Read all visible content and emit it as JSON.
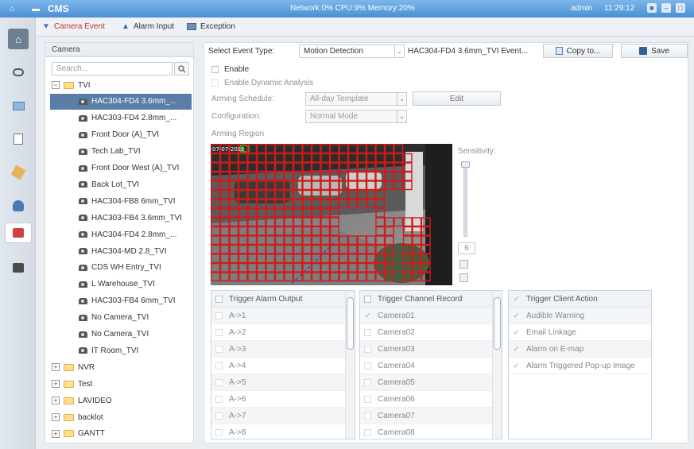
{
  "titlebar": {
    "app_name": "CMS",
    "status": "Network:0% CPU:9% Memory:20%",
    "user": "admin",
    "clock": "11:29:12"
  },
  "tabs": [
    {
      "label": "Camera Event"
    },
    {
      "label": "Alarm Input"
    },
    {
      "label": "Exception"
    }
  ],
  "camera_panel": {
    "header": "Camera",
    "search_placeholder": "Search...",
    "root_folder": "TVI",
    "cameras": [
      "HAC304-FD4 3.6mm_...",
      "HAC303-FD4 2.8mm_...",
      "Front Door (A)_TVI",
      "Tech Lab_TVI",
      "Front Door West (A)_TVI",
      "Back Lot_TVI",
      "HAC304-FB8 6mm_TVI",
      "HAC303-FB4 3.6mm_TVI",
      "HAC304-FD4 2.8mm_...",
      "HAC304-MD 2.8_TVI",
      "CDS WH Entry_TVI",
      "L Warehouse_TVI",
      "HAC303-FB4 6mm_TVI",
      "No Camera_TVI",
      "No Camera_TVI",
      "IT Room_TVI"
    ],
    "folders": [
      "NVR",
      "Test",
      "LAVIDEO",
      "backlot",
      "GANTT"
    ]
  },
  "event": {
    "select_label": "Select Event Type:",
    "event_type": "Motion Detection",
    "camera_name": "HAC304-FD4 3.6mm_TVI Event...",
    "copy_label": "Copy to...",
    "save_label": "Save",
    "enable_label": "Enable",
    "dynamic_label": "Enable Dynamic Analysis",
    "schedule_label": "Arming Schedule:",
    "schedule_value": "All-day Template",
    "edit_label": "Edit",
    "config_label": "Configuration:",
    "config_value": "Normal Mode",
    "region_label": "Arming Region",
    "sensitivity_label": "Sensitivity:",
    "sensitivity_value": "6",
    "osd_date": "07-07-2016"
  },
  "alarm_output": {
    "header": "Trigger Alarm Output",
    "items": [
      "A->1",
      "A->2",
      "A->3",
      "A->4",
      "A->5",
      "A->6",
      "A->7",
      "A->8"
    ]
  },
  "channel_record": {
    "header": "Trigger Channel Record",
    "items": [
      "Camera01",
      "Camera02",
      "Camera03",
      "Camera04",
      "Camera05",
      "Camera06",
      "Camera07",
      "Camera08"
    ]
  },
  "client_action": {
    "header": "Trigger Client Action",
    "items": [
      "Audible Warning",
      "Email Linkage",
      "Alarm on E-map",
      "Alarm Triggered Pop-up Image"
    ]
  },
  "colors": {
    "accent": "#4b8fd3",
    "selected": "#5a7ea8",
    "grid": "#d11a1a"
  }
}
